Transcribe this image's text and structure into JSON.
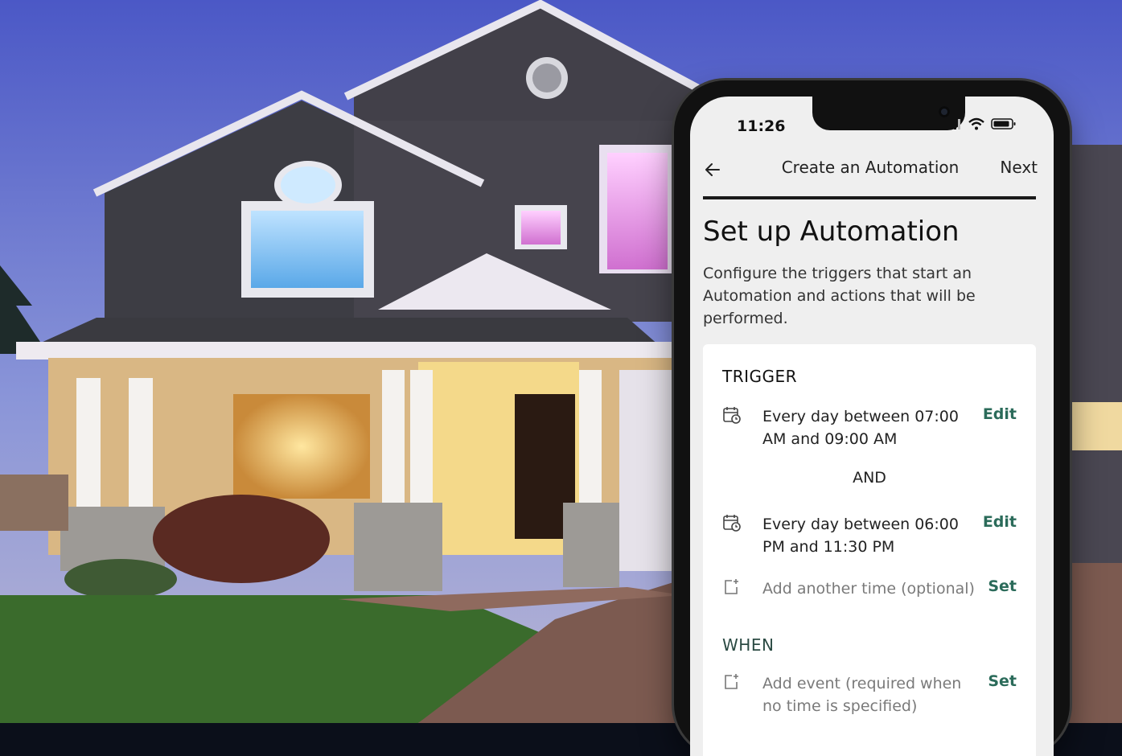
{
  "status_bar": {
    "time": "11:26"
  },
  "header": {
    "title": "Create an Automation",
    "next_label": "Next"
  },
  "page": {
    "title": "Set up Automation",
    "description": "Configure the triggers that start an Automation and actions that will be performed."
  },
  "trigger": {
    "heading": "TRIGGER",
    "items": [
      {
        "text": "Every day between 07:00 AM and 09:00 AM",
        "action": "Edit",
        "icon": "calendar-clock-icon"
      },
      {
        "text": "Every day between 06:00 PM and 11:30 PM",
        "action": "Edit",
        "icon": "calendar-clock-icon"
      },
      {
        "text": "Add another time (optional)",
        "action": "Set",
        "icon": "calendar-add-icon"
      }
    ],
    "and_label": "AND"
  },
  "when": {
    "heading": "WHEN",
    "items": [
      {
        "text": "Add event (required when no time is specified)",
        "action": "Set",
        "icon": "calendar-add-icon"
      }
    ]
  },
  "colors": {
    "accent": "#2b6b5a",
    "screen_bg": "#efefef"
  }
}
